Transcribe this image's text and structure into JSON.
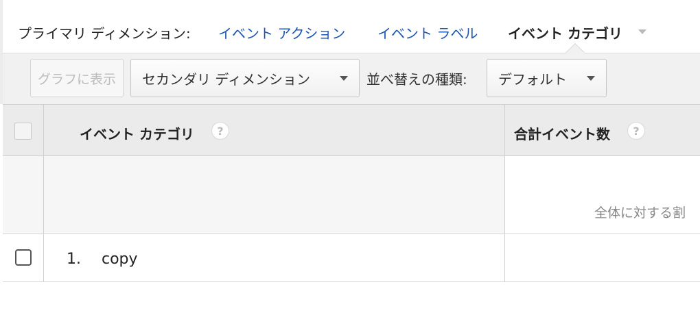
{
  "primary_dimension": {
    "label": "プライマリ ディメンション:",
    "options": [
      {
        "label": "イベント アクション",
        "active": false
      },
      {
        "label": "イベント ラベル",
        "active": false
      },
      {
        "label": "イベント カテゴリ",
        "active": true
      }
    ]
  },
  "toolbar": {
    "graph_button": "グラフに表示",
    "secondary_dimension": "セカンダリ ディメンション",
    "sort_label": "並べ替えの種類:",
    "sort_value": "デフォルト"
  },
  "table": {
    "columns": [
      {
        "label": "イベント カテゴリ",
        "help": "?"
      },
      {
        "label": "合計イベント数",
        "help": "?"
      }
    ],
    "summary_text": "全体に対する割",
    "rows": [
      {
        "num": "1.",
        "value": "copy"
      }
    ]
  },
  "colors": {
    "link": "#1a55b4",
    "header_bg": "#ebebeb",
    "toolbar_bg": "#f1f1f1"
  }
}
